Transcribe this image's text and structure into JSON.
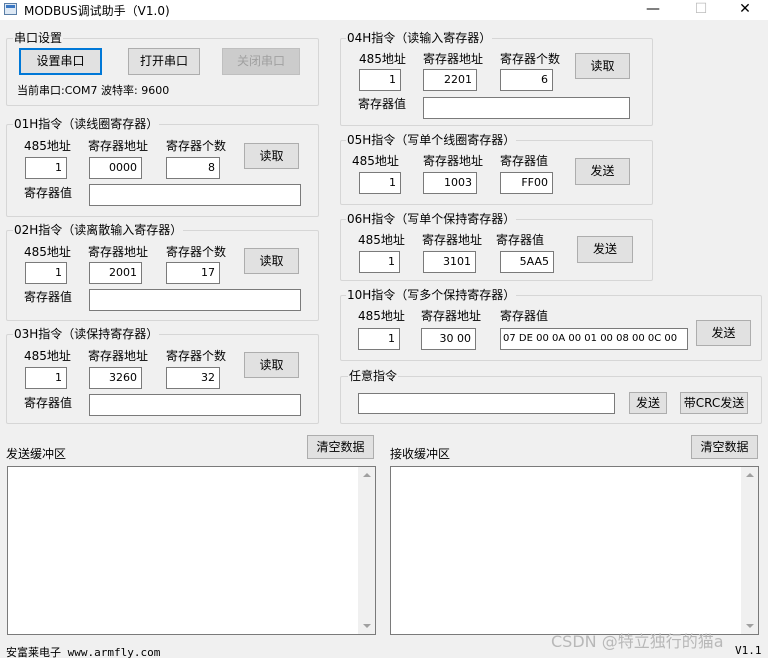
{
  "window": {
    "title": "MODBUS调试助手（V1.0)",
    "minimize": "—",
    "maximize": "☐",
    "close": "✕"
  },
  "serial": {
    "group_label": "串口设置",
    "setup_btn": "设置串口",
    "open_btn": "打开串口",
    "close_btn": "关闭串口",
    "status": "当前串口:COM7 波特率: 9600"
  },
  "labels": {
    "addr485": "485地址",
    "reg_addr": "寄存器地址",
    "reg_count": "寄存器个数",
    "reg_value": "寄存器值",
    "read": "读取",
    "send": "发送",
    "clear": "清空数据"
  },
  "cmd01": {
    "title": "01H指令（读线圈寄存器）",
    "addr485": "1",
    "reg_addr": "0000",
    "reg_count": "8",
    "reg_value": ""
  },
  "cmd02": {
    "title": "02H指令（读离散输入寄存器）",
    "addr485": "1",
    "reg_addr": "2001",
    "reg_count": "17",
    "reg_value": ""
  },
  "cmd03": {
    "title": "03H指令（读保持寄存器）",
    "addr485": "1",
    "reg_addr": "3260",
    "reg_count": "32",
    "reg_value": ""
  },
  "cmd04": {
    "title": "04H指令（读输入寄存器）",
    "addr485": "1",
    "reg_addr": "2201",
    "reg_count": "6",
    "reg_value": ""
  },
  "cmd05": {
    "title": "05H指令（写单个线圈寄存器）",
    "addr485": "1",
    "reg_addr": "1003",
    "reg_value": "FF00"
  },
  "cmd06": {
    "title": "06H指令（写单个保持寄存器）",
    "addr485": "1",
    "reg_addr": "3101",
    "reg_value": "5AA5"
  },
  "cmd10": {
    "title": "10H指令（写多个保持寄存器）",
    "addr485": "1",
    "reg_addr": "30 00",
    "reg_value": "07 DE  00 0A  00 01  00 08  00 0C  00"
  },
  "any": {
    "title": "任意指令",
    "value": "",
    "send_btn": "发送",
    "crc_btn": "带CRC发送"
  },
  "send_buffer": {
    "label": "发送缓冲区",
    "content": ""
  },
  "recv_buffer": {
    "label": "接收缓冲区",
    "content": ""
  },
  "footer": {
    "company": "安富莱电子  www.armfly.com",
    "version": "V1.1"
  },
  "watermark": "CSDN @特立独行的猫a"
}
